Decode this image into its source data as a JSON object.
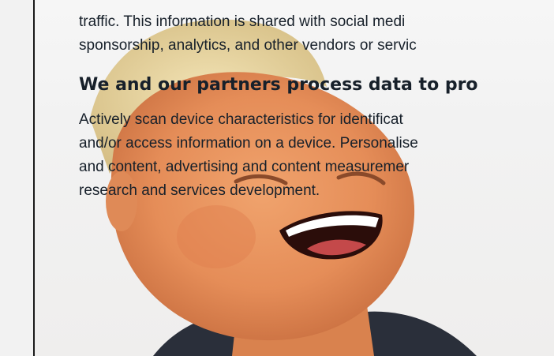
{
  "consent": {
    "intro_lines": [
      "traffic. This information is shared with social medi",
      "sponsorship, analytics, and other vendors or servic"
    ],
    "heading": "We and our partners process data to pro",
    "purposes_lines": [
      "Actively scan device characteristics for identificat",
      "and/or access information on a device. Personalise",
      "and content, advertising and content measuremer",
      "research and services development."
    ]
  },
  "colors": {
    "text": "#17202a",
    "rail_line": "#1a1a1a",
    "skin": "#e79a6a",
    "hair": "#e8d6a2"
  },
  "icons": {
    "background_photo": "laughing-man-photo"
  }
}
